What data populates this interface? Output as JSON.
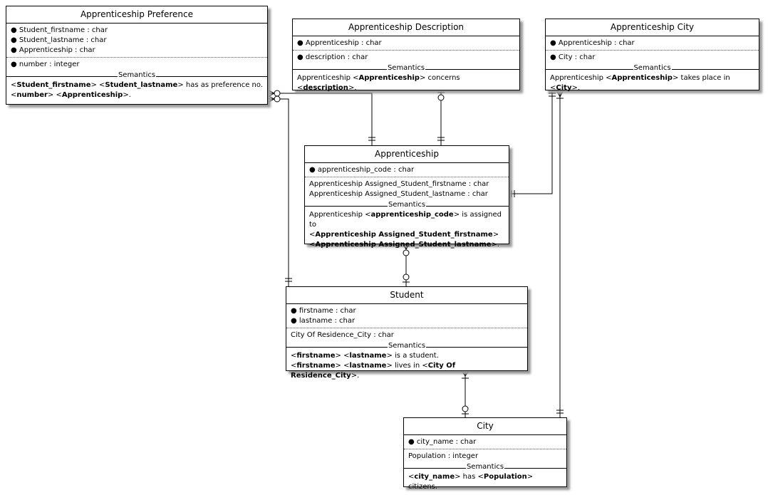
{
  "entities": {
    "pref": {
      "title": "Apprenticeship Preference",
      "keys": [
        "Student_firstname : char",
        "Student_lastname : char",
        "Apprenticeship : char"
      ],
      "attrs": [
        "number : integer"
      ],
      "attrs_bulleted": true,
      "semantics_label": "Semantics",
      "semantics": [
        [
          {
            "t": "<"
          },
          {
            "t": "Student_firstname",
            "b": true
          },
          {
            "t": "> <"
          },
          {
            "t": "Student_lastname",
            "b": true
          },
          {
            "t": "> has as preference no."
          }
        ],
        [
          {
            "t": "<"
          },
          {
            "t": "number",
            "b": true
          },
          {
            "t": "> <"
          },
          {
            "t": "Apprenticeship",
            "b": true
          },
          {
            "t": ">."
          }
        ]
      ]
    },
    "desc": {
      "title": "Apprenticeship Description",
      "keys": [
        "Apprenticeship : char"
      ],
      "attrs": [
        "description : char"
      ],
      "attrs_bulleted": true,
      "semantics_label": "Semantics",
      "semantics": [
        [
          {
            "t": "Apprenticeship <"
          },
          {
            "t": "Apprenticeship",
            "b": true
          },
          {
            "t": "> concerns <"
          },
          {
            "t": "description",
            "b": true
          },
          {
            "t": ">."
          }
        ]
      ]
    },
    "acity": {
      "title": "Apprenticeship City",
      "keys": [
        "Apprenticeship : char"
      ],
      "attrs": [
        "City : char"
      ],
      "attrs_bulleted": true,
      "semantics_label": "Semantics",
      "semantics": [
        [
          {
            "t": "Apprenticeship <"
          },
          {
            "t": "Apprenticeship",
            "b": true
          },
          {
            "t": "> takes place in <"
          },
          {
            "t": "City",
            "b": true
          },
          {
            "t": ">."
          }
        ]
      ]
    },
    "app": {
      "title": "Apprenticeship",
      "keys": [
        "apprenticeship_code : char"
      ],
      "attrs": [
        "Apprenticeship Assigned_Student_firstname : char",
        "Apprenticeship Assigned_Student_lastname : char"
      ],
      "attrs_bulleted": false,
      "semantics_label": "Semantics",
      "semantics": [
        [
          {
            "t": "Apprenticeship <"
          },
          {
            "t": "apprenticeship_code",
            "b": true
          },
          {
            "t": "> is assigned to"
          }
        ],
        [
          {
            "t": "<"
          },
          {
            "t": "Apprenticeship Assigned_Student_firstname",
            "b": true
          },
          {
            "t": ">"
          }
        ],
        [
          {
            "t": "<"
          },
          {
            "t": "Apprenticeship Assigned_Student_lastname",
            "b": true
          },
          {
            "t": ">."
          }
        ]
      ]
    },
    "student": {
      "title": "Student",
      "keys": [
        "firstname : char",
        "lastname : char"
      ],
      "attrs": [
        "City Of Residence_City : char"
      ],
      "attrs_bulleted": false,
      "semantics_label": "Semantics",
      "semantics": [
        [
          {
            "t": "<"
          },
          {
            "t": "firstname",
            "b": true
          },
          {
            "t": "> <"
          },
          {
            "t": "lastname",
            "b": true
          },
          {
            "t": "> is a student."
          }
        ],
        [
          {
            "t": "<"
          },
          {
            "t": "firstname",
            "b": true
          },
          {
            "t": "> <"
          },
          {
            "t": "lastname",
            "b": true
          },
          {
            "t": "> lives in <"
          },
          {
            "t": "City Of Residence_City",
            "b": true
          },
          {
            "t": ">."
          }
        ]
      ]
    },
    "city": {
      "title": "City",
      "keys": [
        "city_name : char"
      ],
      "attrs": [
        "Population : integer"
      ],
      "attrs_bulleted": false,
      "semantics_label": "Semantics",
      "semantics": [
        [
          {
            "t": "<"
          },
          {
            "t": "city_name",
            "b": true
          },
          {
            "t": "> has <"
          },
          {
            "t": "Population",
            "b": true
          },
          {
            "t": "> citizens."
          }
        ]
      ]
    }
  }
}
